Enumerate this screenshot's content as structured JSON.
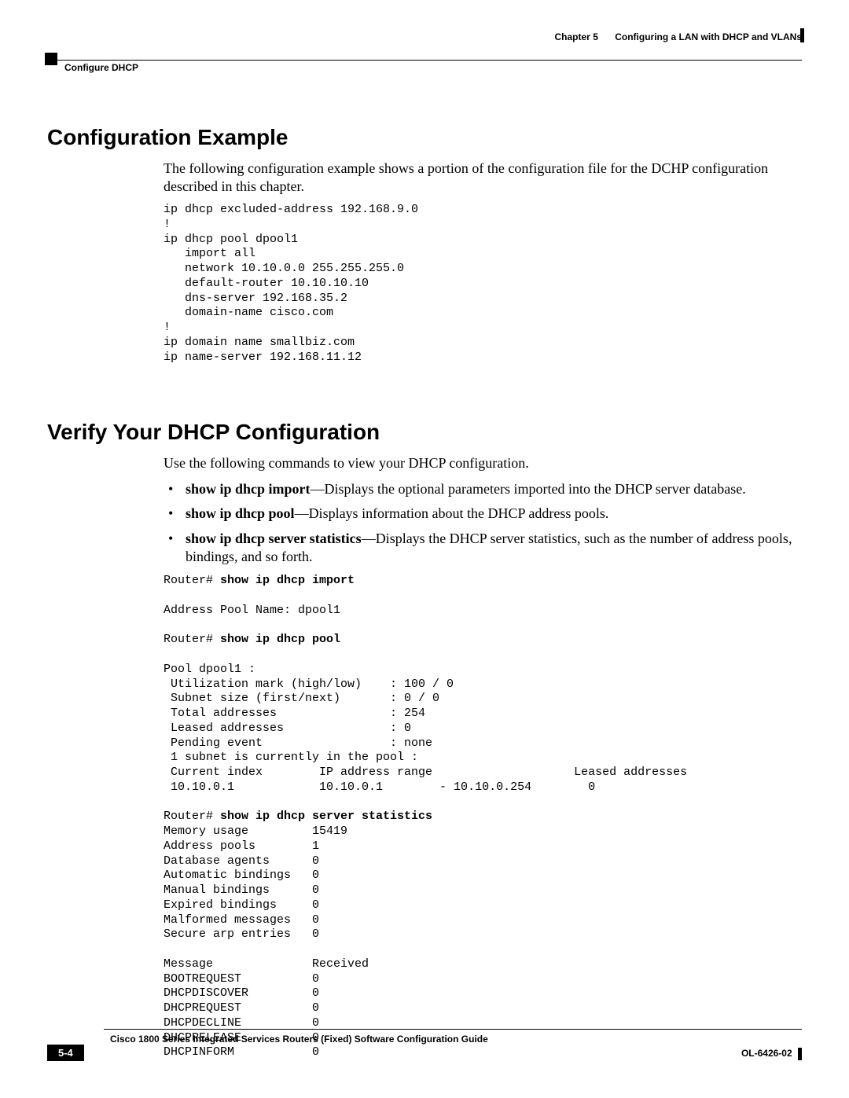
{
  "header": {
    "chapter_label": "Chapter 5",
    "chapter_title": "Configuring a LAN with DHCP and VLANs",
    "section_running": "Configure DHCP"
  },
  "section1": {
    "title": "Configuration Example",
    "intro": "The following configuration example shows a portion of the configuration file for the DCHP configuration described in this chapter.",
    "code": "ip dhcp excluded-address 192.168.9.0\n!\nip dhcp pool dpool1\n   import all\n   network 10.10.0.0 255.255.255.0\n   default-router 10.10.10.10\n   dns-server 192.168.35.2\n   domain-name cisco.com\n!\nip domain name smallbiz.com\nip name-server 192.168.11.12"
  },
  "section2": {
    "title": "Verify Your DHCP Configuration",
    "intro": "Use the following commands to view your DHCP configuration.",
    "bullets": [
      {
        "cmd": "show ip dhcp import",
        "desc": "—Displays the optional parameters imported into the DHCP server database."
      },
      {
        "cmd": "show ip dhcp pool",
        "desc": "—Displays information about the DHCP address pools."
      },
      {
        "cmd": "show ip dhcp server statistics",
        "desc": "—Displays the DHCP server statistics, such as the number of address pools, bindings, and so forth."
      }
    ],
    "output_prefix1": "Router# ",
    "output_cmd1": "show ip dhcp import",
    "output_body1": "\n\nAddress Pool Name: dpool1\n\n",
    "output_prefix2": "Router# ",
    "output_cmd2": "show ip dhcp pool",
    "output_body2": "\n\nPool dpool1 :\n Utilization mark (high/low)    : 100 / 0\n Subnet size (first/next)       : 0 / 0\n Total addresses                : 254\n Leased addresses               : 0\n Pending event                  : none\n 1 subnet is currently in the pool :\n Current index        IP address range                    Leased addresses\n 10.10.0.1            10.10.0.1        - 10.10.0.254        0\n\n",
    "output_prefix3": "Router# ",
    "output_cmd3": "show ip dhcp server statistics",
    "output_body3": "\nMemory usage         15419\nAddress pools        1\nDatabase agents      0\nAutomatic bindings   0\nManual bindings      0\nExpired bindings     0\nMalformed messages   0\nSecure arp entries   0\n\nMessage              Received\nBOOTREQUEST          0\nDHCPDISCOVER         0\nDHCPREQUEST          0\nDHCPDECLINE          0\nDHCPRELEASE          0\nDHCPINFORM           0"
  },
  "footer": {
    "book_title": "Cisco 1800 Series Integrated Services Routers (Fixed) Software Configuration Guide",
    "page_number": "5-4",
    "doc_id": "OL-6426-02"
  }
}
